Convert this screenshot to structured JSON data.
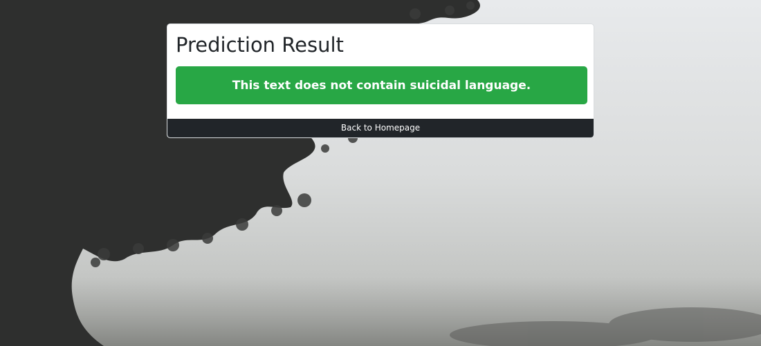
{
  "card": {
    "title": "Prediction Result",
    "result_message": "This text does not contain suicidal language.",
    "back_button_label": "Back to Homepage"
  },
  "colors": {
    "success": "#28a745",
    "button_dark": "#212529",
    "text_dark": "#212529"
  }
}
